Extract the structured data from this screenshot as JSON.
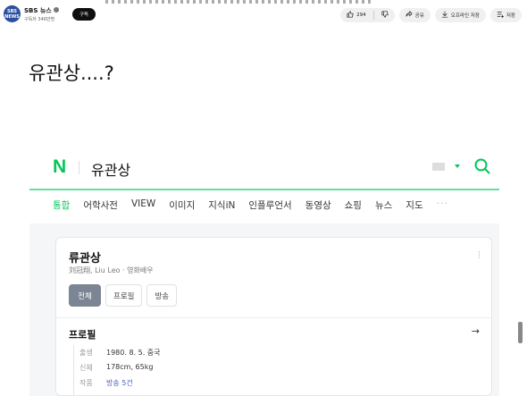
{
  "youtube": {
    "avatar_text_top": "SBS",
    "avatar_text_bottom": "NEWS",
    "channel_name": "SBS 뉴스",
    "subscribers": "구독자 346만명",
    "subscribe_label": "구독",
    "like_count": "294",
    "share_label": "공유",
    "download_label": "오프라인 저장",
    "save_label": "저장"
  },
  "caption": "유관상....?",
  "naver": {
    "logo": "N",
    "query": "유관상",
    "tabs": [
      {
        "label": "통합",
        "active": true
      },
      {
        "label": "어학사전"
      },
      {
        "label": "VIEW"
      },
      {
        "label": "이미지"
      },
      {
        "label": "지식iN"
      },
      {
        "label": "인플루언서"
      },
      {
        "label": "동영상"
      },
      {
        "label": "쇼핑"
      },
      {
        "label": "뉴스"
      },
      {
        "label": "지도"
      },
      {
        "label": "···"
      }
    ],
    "accent_color": "#03c75a"
  },
  "profile_card": {
    "name": "류관상",
    "subtitle": "刘冠翔, Liu Leo · 영화배우",
    "tabs": [
      "전체",
      "프로필",
      "방송"
    ],
    "active_tab": "전체",
    "section_title": "프로필",
    "rows": [
      {
        "key": "출생",
        "value": "1980. 8. 5. 중국"
      },
      {
        "key": "신체",
        "value": "178cm, 65kg"
      },
      {
        "key": "작품",
        "value": "방송 5건"
      }
    ]
  }
}
